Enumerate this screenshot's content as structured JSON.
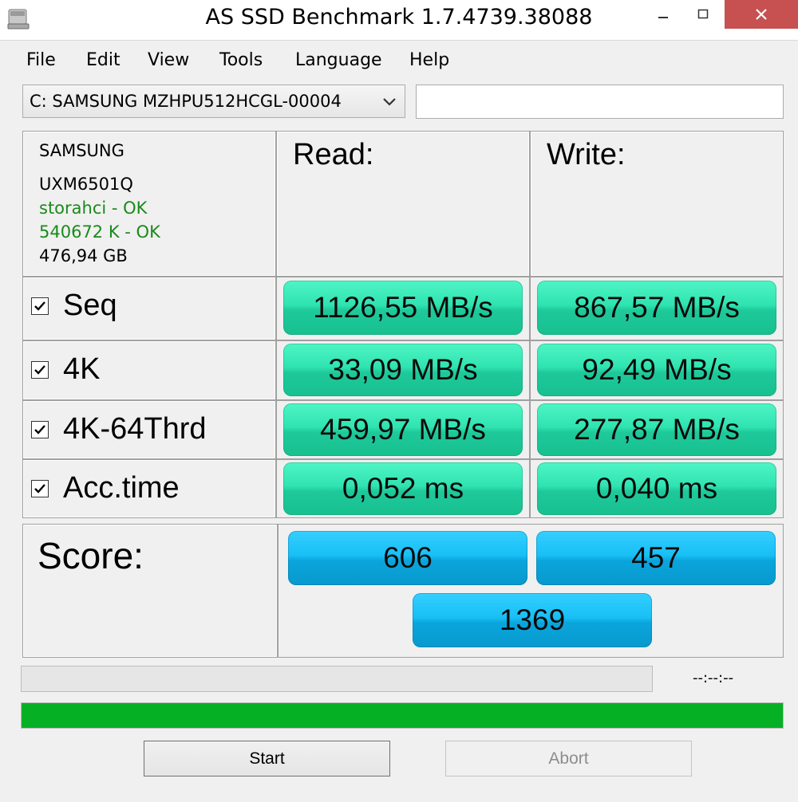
{
  "window": {
    "title": "AS SSD Benchmark 1.7.4739.38088"
  },
  "menu": {
    "items": [
      "File",
      "Edit",
      "View",
      "Tools",
      "Language",
      "Help"
    ]
  },
  "drive": {
    "selected": "C: SAMSUNG MZHPU512HCGL-00004",
    "textbox_value": ""
  },
  "info": {
    "vendor": "SAMSUNG",
    "firmware": "UXM6501Q",
    "driver_status": "storahci - OK",
    "alignment_status": "540672 K - OK",
    "capacity": "476,94 GB"
  },
  "columns": {
    "read": "Read:",
    "write": "Write:"
  },
  "rows": [
    {
      "label": "Seq",
      "checked": true,
      "read": "1126,55 MB/s",
      "write": "867,57 MB/s"
    },
    {
      "label": "4K",
      "checked": true,
      "read": "33,09 MB/s",
      "write": "92,49 MB/s"
    },
    {
      "label": "4K-64Thrd",
      "checked": true,
      "read": "459,97 MB/s",
      "write": "277,87 MB/s"
    },
    {
      "label": "Acc.time",
      "checked": true,
      "read": "0,052 ms",
      "write": "0,040 ms"
    }
  ],
  "score": {
    "label": "Score:",
    "read": "606",
    "write": "457",
    "total": "1369"
  },
  "progress": {
    "time": "--:--:--",
    "small_fraction": 0,
    "main_fraction": 1.0
  },
  "buttons": {
    "start": "Start",
    "abort": "Abort"
  },
  "colors": {
    "ok_text": "#1a8a1a",
    "result_green": "#2fe3b0",
    "score_blue": "#18bff5",
    "progress_green": "#06b025",
    "close_button": "#c75050"
  }
}
